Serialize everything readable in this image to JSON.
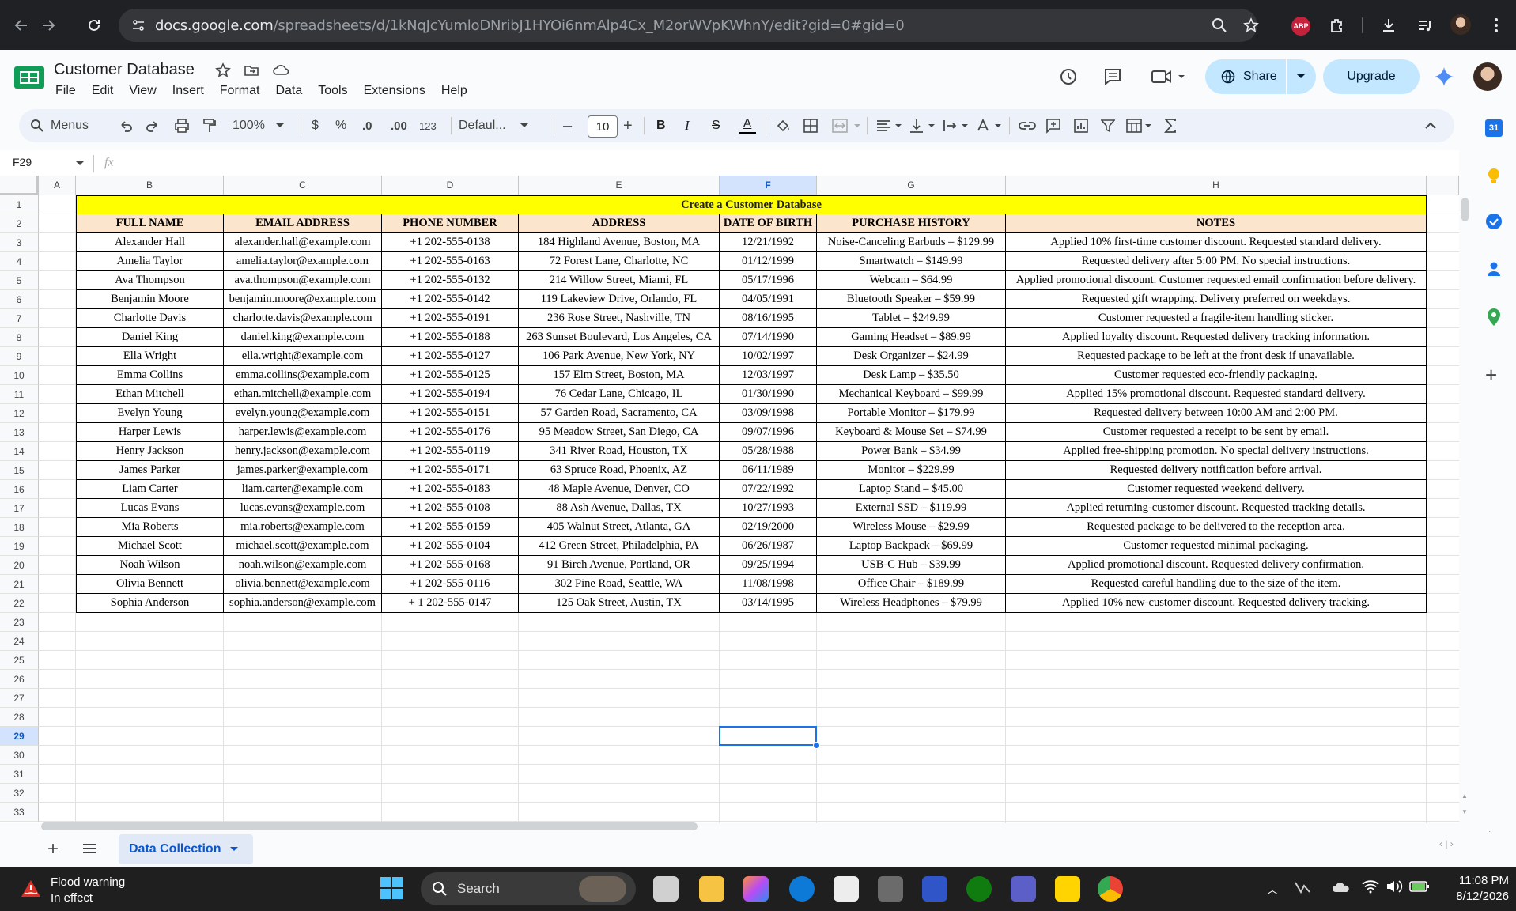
{
  "browser": {
    "url_host": "docs.google.com",
    "url_path": "/spreadsheets/d/1kNqJcYumloDNribJ1HYOi6nmAlp4Cx_M2orWVpKWhnY/edit?gid=0#gid=0",
    "extension_badge": "ABP"
  },
  "app": {
    "doc_title": "Customer Database",
    "menus": [
      "File",
      "Edit",
      "View",
      "Insert",
      "Format",
      "Data",
      "Tools",
      "Extensions",
      "Help"
    ],
    "share_label": "Share",
    "upgrade_label": "Upgrade"
  },
  "toolbar": {
    "menus_label": "Menus",
    "zoom": "100%",
    "currency": "$",
    "percent": "%",
    "dec_decrease": ".0",
    "dec_increase": ".00",
    "number_format": "123",
    "font": "Defaul...",
    "font_size": "10",
    "bold": "B",
    "italic": "I",
    "strike": "S",
    "textcolor": "A"
  },
  "formula_bar": {
    "name_box": "F29",
    "fx": "fx",
    "value": ""
  },
  "columns": [
    "A",
    "B",
    "C",
    "D",
    "E",
    "F",
    "G",
    "H"
  ],
  "selected_column": "F",
  "rows": [
    "1",
    "2",
    "3",
    "4",
    "5",
    "6",
    "7",
    "8",
    "9",
    "10",
    "11",
    "12",
    "13",
    "14",
    "15",
    "16",
    "17",
    "18",
    "19",
    "20",
    "21",
    "22",
    "23",
    "24",
    "25",
    "26",
    "27",
    "28",
    "29",
    "30",
    "31",
    "32",
    "33"
  ],
  "selected_row": "29",
  "sheet": {
    "title": "Create a Customer Database",
    "headers": [
      "FULL NAME",
      "EMAIL ADDRESS",
      "PHONE NUMBER",
      "ADDRESS",
      "DATE OF BIRTH",
      "PURCHASE HISTORY",
      "NOTES"
    ],
    "records": [
      [
        "Alexander Hall",
        "alexander.hall@example.com",
        "+1 202-555-0138",
        "184 Highland Avenue, Boston, MA",
        "12/21/1992",
        "Noise-Canceling Earbuds – $129.99",
        "Applied 10% first-time customer discount. Requested standard delivery."
      ],
      [
        "Amelia Taylor",
        "amelia.taylor@example.com",
        "+1 202-555-0163",
        "72 Forest Lane, Charlotte, NC",
        "01/12/1999",
        "Smartwatch – $149.99",
        "Requested delivery after 5:00 PM. No special instructions."
      ],
      [
        "Ava Thompson",
        "ava.thompson@example.com",
        "+1 202-555-0132",
        "214 Willow Street, Miami, FL",
        "05/17/1996",
        "Webcam – $64.99",
        "Applied promotional discount. Customer requested email confirmation before delivery."
      ],
      [
        "Benjamin Moore",
        "benjamin.moore@example.com",
        "+1 202-555-0142",
        "119 Lakeview Drive, Orlando, FL",
        "04/05/1991",
        "Bluetooth Speaker – $59.99",
        "Requested gift wrapping. Delivery preferred on weekdays."
      ],
      [
        "Charlotte Davis",
        "charlotte.davis@example.com",
        "+1 202-555-0191",
        "236 Rose Street, Nashville, TN",
        "08/16/1995",
        "Tablet – $249.99",
        "Customer requested a fragile-item handling sticker."
      ],
      [
        "Daniel King",
        "daniel.king@example.com",
        "+1 202-555-0188",
        "263 Sunset Boulevard, Los Angeles, CA",
        "07/14/1990",
        "Gaming Headset – $89.99",
        "Applied loyalty discount. Requested delivery tracking information."
      ],
      [
        "Ella Wright",
        "ella.wright@example.com",
        "+1 202-555-0127",
        "106 Park Avenue, New York, NY",
        "10/02/1997",
        "Desk Organizer – $24.99",
        "Requested package to be left at the front desk if unavailable."
      ],
      [
        "Emma Collins",
        "emma.collins@example.com",
        "+1 202-555-0125",
        "157 Elm Street, Boston, MA",
        "12/03/1997",
        "Desk Lamp – $35.50",
        "Customer requested eco-friendly packaging."
      ],
      [
        "Ethan Mitchell",
        "ethan.mitchell@example.com",
        "+1 202-555-0194",
        "76 Cedar Lane, Chicago, IL",
        "01/30/1990",
        "Mechanical Keyboard – $99.99",
        "Applied 15% promotional discount. Requested standard delivery."
      ],
      [
        "Evelyn Young",
        "evelyn.young@example.com",
        "+1 202-555-0151",
        "57 Garden Road, Sacramento, CA",
        "03/09/1998",
        "Portable Monitor – $179.99",
        "Requested delivery between 10:00 AM and 2:00 PM."
      ],
      [
        "Harper Lewis",
        "harper.lewis@example.com",
        "+1 202-555-0176",
        "95 Meadow Street, San Diego, CA",
        "09/07/1996",
        "Keyboard & Mouse Set – $74.99",
        "Customer requested a receipt to be sent by email."
      ],
      [
        "Henry Jackson",
        "henry.jackson@example.com",
        "+1 202-555-0119",
        "341 River Road, Houston, TX",
        "05/28/1988",
        "Power Bank – $34.99",
        "Applied free-shipping promotion. No special delivery instructions."
      ],
      [
        "James Parker",
        "james.parker@example.com",
        "+1 202-555-0171",
        "63 Spruce Road, Phoenix, AZ",
        "06/11/1989",
        "Monitor – $229.99",
        "Requested delivery notification before arrival."
      ],
      [
        "Liam Carter",
        "liam.carter@example.com",
        "+1 202-555-0183",
        "48 Maple Avenue, Denver, CO",
        "07/22/1992",
        "Laptop Stand – $45.00",
        "Customer requested weekend delivery."
      ],
      [
        "Lucas Evans",
        "lucas.evans@example.com",
        "+1 202-555-0108",
        "88 Ash Avenue, Dallas, TX",
        "10/27/1993",
        "External SSD – $119.99",
        "Applied returning-customer discount. Requested tracking details."
      ],
      [
        "Mia Roberts",
        "mia.roberts@example.com",
        "+1 202-555-0159",
        "405 Walnut Street, Atlanta, GA",
        "02/19/2000",
        "Wireless Mouse – $29.99",
        "Requested package to be delivered to the reception area."
      ],
      [
        "Michael Scott",
        "michael.scott@example.com",
        "+1 202-555-0104",
        "412 Green Street, Philadelphia, PA",
        "06/26/1987",
        "Laptop Backpack – $69.99",
        "Customer requested minimal packaging."
      ],
      [
        "Noah Wilson",
        "noah.wilson@example.com",
        "+1 202-555-0168",
        "91 Birch Avenue, Portland, OR",
        "09/25/1994",
        "USB-C Hub – $39.99",
        "Applied promotional discount. Requested delivery confirmation."
      ],
      [
        "Olivia Bennett",
        "olivia.bennett@example.com",
        "+1 202-555-0116",
        "302 Pine Road, Seattle, WA",
        "11/08/1998",
        "Office Chair – $189.99",
        "Requested careful handling due to the size of the item."
      ],
      [
        "Sophia Anderson",
        "sophia.anderson@example.com",
        "+ 1 202-555-0147",
        "125 Oak Street, Austin, TX",
        "03/14/1995",
        "Wireless Headphones – $79.99",
        "Applied 10% new-customer discount. Requested delivery tracking."
      ]
    ]
  },
  "tabs": {
    "add": "+",
    "active": "Data Collection"
  },
  "taskbar": {
    "weather_title": "Flood warning",
    "weather_sub": "In effect",
    "search_label": "Search",
    "time": "11:08 PM",
    "date": "8/12/2026"
  },
  "sidepanel": {
    "calendar_day": "31"
  },
  "colors": {
    "header_fill": "#fce5cd",
    "title_fill": "#ffff00",
    "selection": "#1a73e8",
    "share_bg": "#c2e7ff"
  }
}
